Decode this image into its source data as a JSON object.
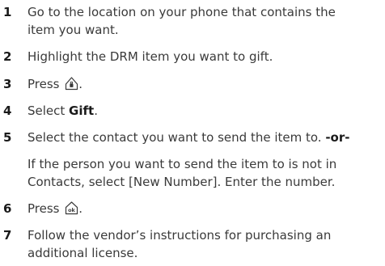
{
  "steps": [
    {
      "number": "1",
      "lines": [
        "Go to the location on your phone that contains the",
        "item you want."
      ]
    },
    {
      "number": "2",
      "lines": [
        "Highlight the DRM item you want to gift."
      ]
    },
    {
      "number": "3",
      "text_before": "Press",
      "icon": "menu-key-icon",
      "text_after": "."
    },
    {
      "number": "4",
      "text_before": "Select ",
      "bold": "Gift",
      "text_after": "."
    },
    {
      "number": "5",
      "text_before": "Select the contact you want to send the item to. ",
      "bold": "-or-"
    },
    {
      "number": "",
      "lines": [
        "If the person you want to send the item to is not in",
        "Contacts, select [New Number]. Enter the number."
      ]
    },
    {
      "number": "6",
      "text_before": "Press",
      "icon": "ok-key-icon",
      "text_after": "."
    },
    {
      "number": "7",
      "lines": [
        "Follow the vendor’s instructions for purchasing an",
        "additional license."
      ]
    }
  ]
}
